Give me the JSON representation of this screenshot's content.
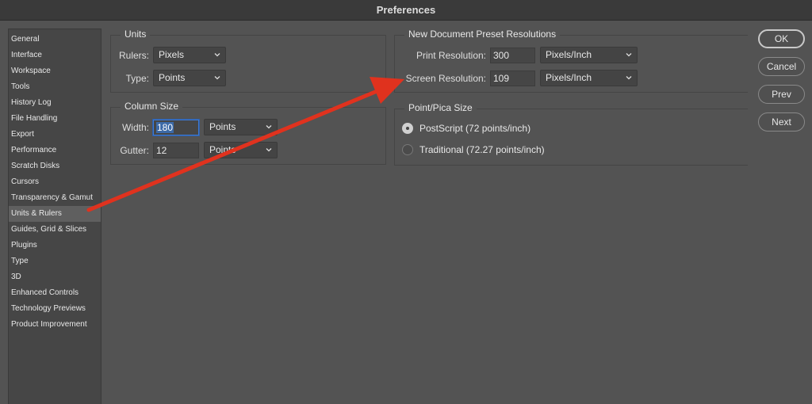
{
  "window": {
    "title": "Preferences"
  },
  "sidebar": {
    "items": [
      {
        "label": "General"
      },
      {
        "label": "Interface"
      },
      {
        "label": "Workspace"
      },
      {
        "label": "Tools"
      },
      {
        "label": "History Log"
      },
      {
        "label": "File Handling"
      },
      {
        "label": "Export"
      },
      {
        "label": "Performance"
      },
      {
        "label": "Scratch Disks"
      },
      {
        "label": "Cursors"
      },
      {
        "label": "Transparency & Gamut"
      },
      {
        "label": "Units & Rulers"
      },
      {
        "label": "Guides, Grid & Slices"
      },
      {
        "label": "Plugins"
      },
      {
        "label": "Type"
      },
      {
        "label": "3D"
      },
      {
        "label": "Enhanced Controls"
      },
      {
        "label": "Technology Previews"
      },
      {
        "label": "Product Improvement"
      }
    ],
    "active": "Units & Rulers"
  },
  "units": {
    "title": "Units",
    "rulers_label": "Rulers:",
    "rulers_value": "Pixels",
    "type_label": "Type:",
    "type_value": "Points"
  },
  "column_size": {
    "title": "Column Size",
    "width_label": "Width:",
    "width_value": "180",
    "width_unit": "Points",
    "gutter_label": "Gutter:",
    "gutter_value": "12",
    "gutter_unit": "Points"
  },
  "preset_resolutions": {
    "title": "New Document Preset Resolutions",
    "print_label": "Print Resolution:",
    "print_value": "300",
    "print_unit": "Pixels/Inch",
    "screen_label": "Screen Resolution:",
    "screen_value": "109",
    "screen_unit": "Pixels/Inch"
  },
  "point_pica": {
    "title": "Point/Pica Size",
    "options": [
      {
        "label": "PostScript (72 points/inch)",
        "selected": true
      },
      {
        "label": "Traditional (72.27 points/inch)",
        "selected": false
      }
    ]
  },
  "buttons": {
    "ok": "OK",
    "cancel": "Cancel",
    "prev": "Prev",
    "next": "Next"
  },
  "colors": {
    "annotation_arrow": "#e0321e",
    "selection_highlight": "#3c6aa8"
  }
}
